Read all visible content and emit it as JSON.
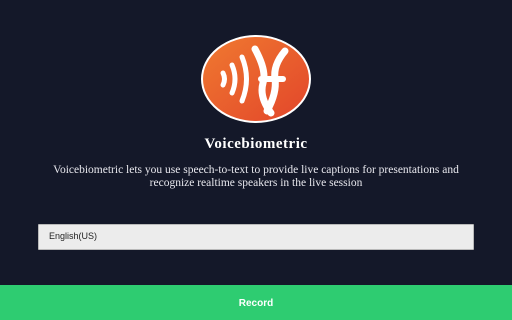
{
  "app": {
    "title": "Voicebiometric",
    "description": "Voicebiometric lets you use speech-to-text to provide live captions for presentations and recognize realtime speakers in the live session",
    "logo_icon": "voice-wave-logo-icon"
  },
  "language": {
    "selected": "English(US)"
  },
  "actions": {
    "record_label": "Record"
  },
  "colors": {
    "background": "#141829",
    "logo_orange": "#ec6a2e",
    "logo_red": "#e0452a",
    "record_green": "#2ecc71"
  }
}
